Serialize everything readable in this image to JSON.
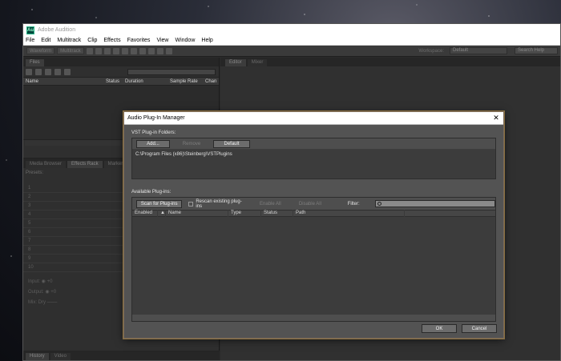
{
  "app": {
    "title": "Adobe Audition",
    "logo_text": "Au",
    "menu": [
      "File",
      "Edit",
      "Multitrack",
      "Clip",
      "Effects",
      "Favorites",
      "View",
      "Window",
      "Help"
    ]
  },
  "toolbar": {
    "waveform_label": "Waveform",
    "multitrack_label": "Multitrack",
    "workspace_label": "Workspace:",
    "workspace_value": "Default",
    "search_help": "Search Help"
  },
  "files_panel": {
    "tab": "Files",
    "columns": [
      "Name",
      "Status",
      "Duration",
      "Sample Rate",
      "Chan"
    ]
  },
  "effects_panel": {
    "tabs": [
      "Media Browser",
      "Effects Rack",
      "Markers"
    ],
    "presets_label": "Presets:",
    "slots": [
      "1",
      "2",
      "3",
      "4",
      "5",
      "6",
      "7",
      "8",
      "9",
      "10"
    ],
    "input_label": "Input:",
    "input_value": "+0",
    "output_label": "Output:",
    "output_value": "+0",
    "mix_label": "Mix:",
    "mix_dry": "Dry"
  },
  "bottom_panel": {
    "tabs": [
      "History",
      "Video"
    ]
  },
  "editor": {
    "tabs": [
      "Editor",
      "Mixer"
    ]
  },
  "dialog": {
    "title": "Audio Plug-In Manager",
    "vst_section_label": "VST Plug-in Folders:",
    "add_button": "Add...",
    "remove_button": "Remove",
    "default_button": "Default",
    "vst_folders": [
      "C:\\Program Files (x86)\\Steinberg\\VSTPlugins"
    ],
    "available_label": "Available Plug-ins:",
    "scan_button": "Scan for Plug-ins",
    "rescan_label": "Rescan existing plug-ins",
    "enable_all": "Enable All",
    "disable_all": "Disable All",
    "filter_label": "Filter:",
    "filter_placeholder": "",
    "columns": [
      "Enabled",
      "Name",
      "Type",
      "Status",
      "Path"
    ],
    "ok_button": "OK",
    "cancel_button": "Cancel"
  }
}
